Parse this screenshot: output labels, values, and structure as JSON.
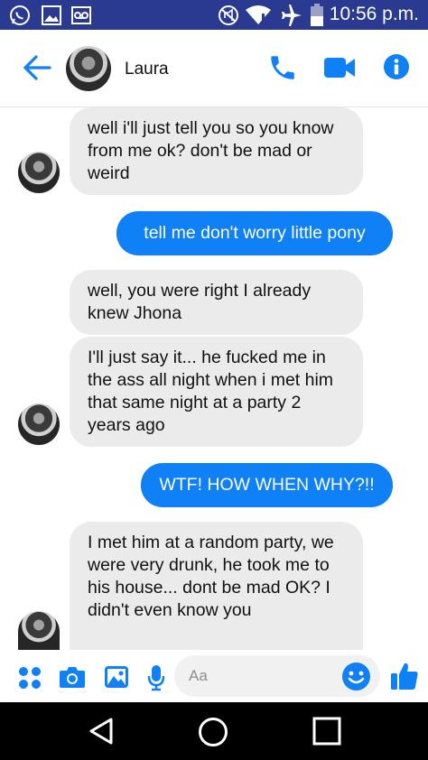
{
  "status_bar": {
    "time": "10:56 p.m.",
    "icons": [
      "whatsapp-icon",
      "gallery-icon",
      "voicemail-icon",
      "mute-icon",
      "wifi-icon",
      "airplane-icon",
      "battery-icon"
    ]
  },
  "header": {
    "contact_name": "Laura",
    "icons": [
      "back-arrow-icon",
      "phone-icon",
      "video-icon",
      "info-icon"
    ],
    "accent_color": "#0f80f6"
  },
  "messages": [
    {
      "direction": "in",
      "text": "well i'll just tell you so you know from me ok? don't be mad or weird"
    },
    {
      "direction": "out",
      "text": "tell me don't worry little pony"
    },
    {
      "direction": "in",
      "text": "well, you were right I already knew Jhona"
    },
    {
      "direction": "in",
      "text": "I'll just say it... he fucked me in the ass all night when i met him that same night at a party 2 years ago"
    },
    {
      "direction": "out",
      "text": "WTF! HOW WHEN WHY?!!"
    },
    {
      "direction": "in",
      "text": "I met him at a random party, we were very drunk, he took me to his house... dont be mad OK? I didn't even know you"
    }
  ],
  "composer": {
    "placeholder": "Aa",
    "icons": [
      "apps-icon",
      "camera-icon",
      "image-icon",
      "microphone-icon",
      "emoji-icon",
      "thumbs-up-icon"
    ]
  },
  "navbar": {
    "icons": [
      "back-triangle-icon",
      "home-circle-icon",
      "recents-square-icon"
    ]
  }
}
